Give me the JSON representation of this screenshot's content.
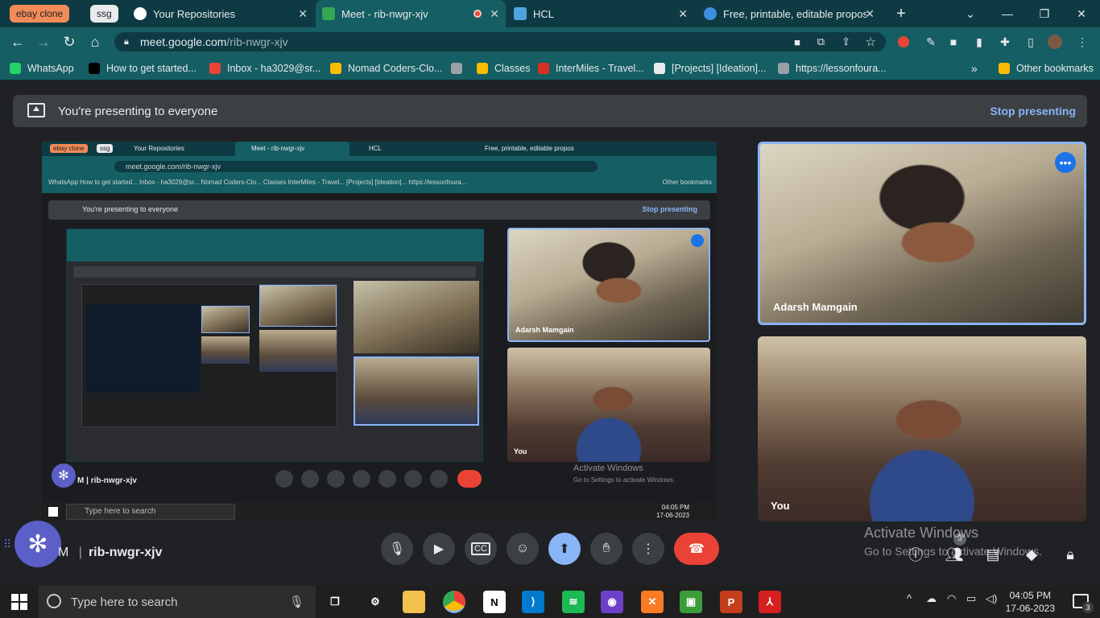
{
  "browser": {
    "tab_groups": [
      {
        "label": "ebay clone",
        "color": "#f28b57"
      },
      {
        "label": "ssg",
        "color": "#e8eaed"
      }
    ],
    "tabs": [
      {
        "label": "Your Repositories",
        "icon": "github-icon"
      },
      {
        "label": "Meet - rib-nwgr-xjv",
        "icon": "meet-icon"
      },
      {
        "label": "HCL",
        "icon": "hcl-icon"
      },
      {
        "label": "Free, printable, editable proposa",
        "icon": "canva-icon"
      }
    ],
    "new_tab": "+",
    "url_host": "meet.google.com",
    "url_path": "/rib-nwgr-xjv",
    "bookmarks": [
      {
        "label": "WhatsApp",
        "color": "#25d366"
      },
      {
        "label": "How to get started...",
        "color": "#000000"
      },
      {
        "label": "Inbox - ha3029@sr...",
        "color": "#ea4335"
      },
      {
        "label": "Nomad Coders-Clo...",
        "color": "#fbbc04"
      },
      {
        "label": "",
        "color": "#9aa0a6"
      },
      {
        "label": "Classes",
        "color": "#fbbc04"
      },
      {
        "label": "InterMiles - Travel...",
        "color": "#d93025"
      },
      {
        "label": "[Projects] [Ideation]...",
        "color": "#e8eaed"
      },
      {
        "label": "https://lessonfoura...",
        "color": "#9aa0a6"
      }
    ],
    "bookmarks_more": "»",
    "other_bookmarks": "Other bookmarks"
  },
  "meet": {
    "banner_text": "You're presenting to everyone",
    "stop_presenting": "Stop presenting",
    "meeting_initial": "M",
    "meeting_code": "rib-nwgr-xjv",
    "participants": [
      {
        "name": "Adarsh Mamgain"
      },
      {
        "name": "You"
      }
    ],
    "people_count": "3",
    "watermark_title": "Activate Windows",
    "watermark_sub": "Go to Settings to activate Windows."
  },
  "shared_screen": {
    "tab_groups": [
      "ebay clone",
      "ssg"
    ],
    "tabs": [
      "Your Repositories",
      "Meet - rib-nwgr-xjv",
      "HCL",
      "Free, printable, editable propos"
    ],
    "url": "meet.google.com/rib-nwgr-xjv",
    "bookmarks_line": "WhatsApp   How to get started...   Inbox - ha3029@sr...   Nomad Coders-Clo...   Classes   InterMiles - Travel...   [Projects] [Ideation]...   https://lessonfoura...",
    "other_bookmarks": "Other bookmarks",
    "banner_text": "You're presenting to everyone",
    "stop_presenting": "Stop presenting",
    "meeting_initial": "M",
    "meeting_code": "rib-nwgr-xjv",
    "tile_names": [
      "Adarsh Mamgain",
      "You"
    ],
    "taskbar_search": "Type here to search",
    "time": "04:05 PM",
    "date": "17-06-2023",
    "watermark_title": "Activate Windows",
    "watermark_sub": "Go to Settings to activate Windows."
  },
  "taskbar": {
    "search_placeholder": "Type here to search",
    "apps": [
      {
        "name": "task-view",
        "color": "#1f1f1f",
        "glyph": "❐"
      },
      {
        "name": "settings",
        "color": "#1f1f1f",
        "glyph": "⚙"
      },
      {
        "name": "file-explorer",
        "color": "#f2c14e",
        "glyph": ""
      },
      {
        "name": "chrome",
        "color": "#34a853",
        "glyph": ""
      },
      {
        "name": "notion",
        "color": "#ffffff",
        "glyph": "N"
      },
      {
        "name": "vscode",
        "color": "#007acc",
        "glyph": "⟩"
      },
      {
        "name": "spotify",
        "color": "#1db954",
        "glyph": "≋"
      },
      {
        "name": "github-desktop",
        "color": "#6e40c9",
        "glyph": "◉"
      },
      {
        "name": "xampp",
        "color": "#fb7a24",
        "glyph": "✕"
      },
      {
        "name": "camtasia",
        "color": "#3a9d3a",
        "glyph": "▣"
      },
      {
        "name": "powerpoint",
        "color": "#c43e1c",
        "glyph": "P"
      },
      {
        "name": "acrobat",
        "color": "#d61f1f",
        "glyph": "⅄"
      }
    ],
    "time": "04:05 PM",
    "date": "17-06-2023",
    "notification_count": "3"
  }
}
